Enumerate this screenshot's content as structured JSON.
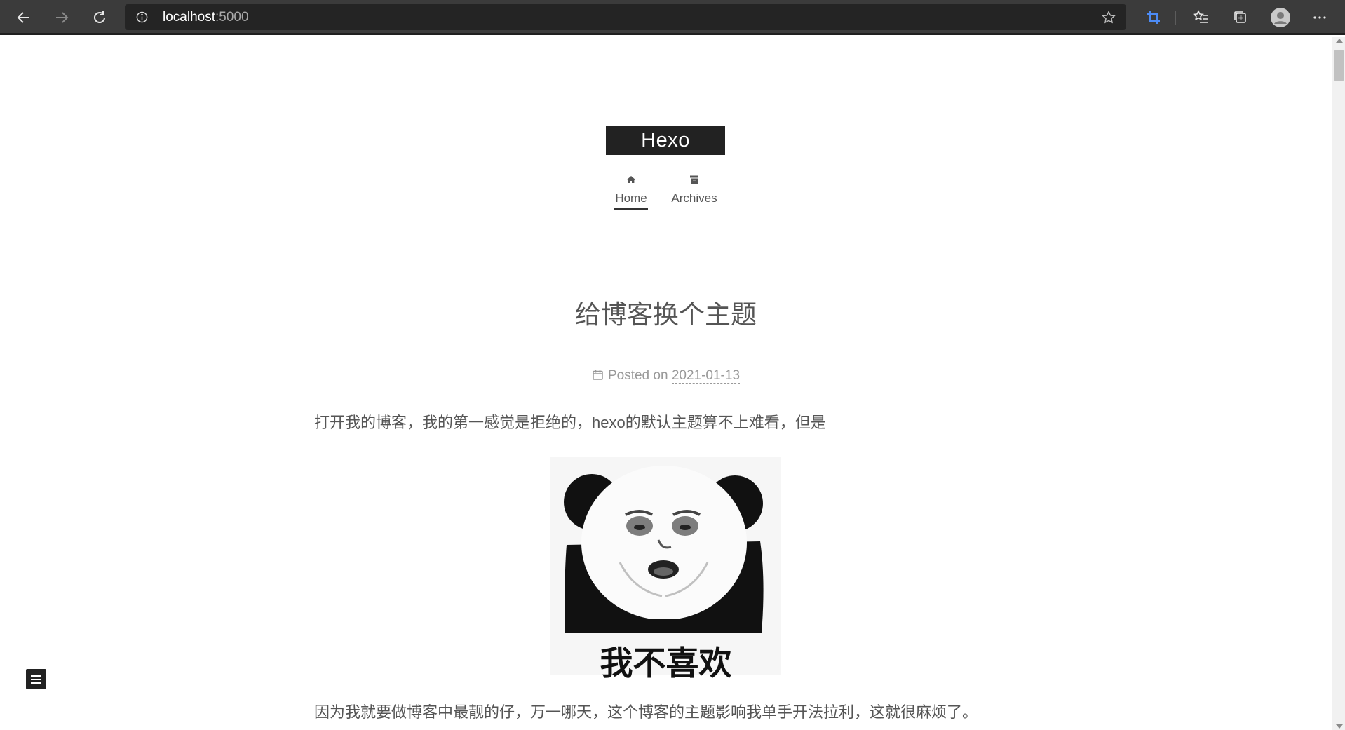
{
  "browser": {
    "url_host": "localhost",
    "url_port": ":5000"
  },
  "blog": {
    "brand": "Hexo",
    "nav": [
      {
        "label": "Home",
        "icon": "home-icon",
        "active": true
      },
      {
        "label": "Archives",
        "icon": "archive-icon",
        "active": false
      }
    ]
  },
  "post": {
    "title": "给博客换个主题",
    "meta_prefix": "Posted on",
    "date": "2021-01-13",
    "paragraph_1": "打开我的博客，我的第一感觉是拒绝的，hexo的默认主题算不上难看，但是",
    "meme_caption": "我不喜欢",
    "paragraph_2": "因为我就要做博客中最靓的仔，万一哪天，这个博客的主题影响我单手开法拉利，这就很麻烦了。"
  },
  "colors": {
    "toolbar_bg": "#3b3b3b",
    "address_bg": "#242424",
    "brand_bg": "#222222",
    "text": "#555555",
    "meta": "#999999",
    "accent_blue": "#4c8bf5"
  }
}
